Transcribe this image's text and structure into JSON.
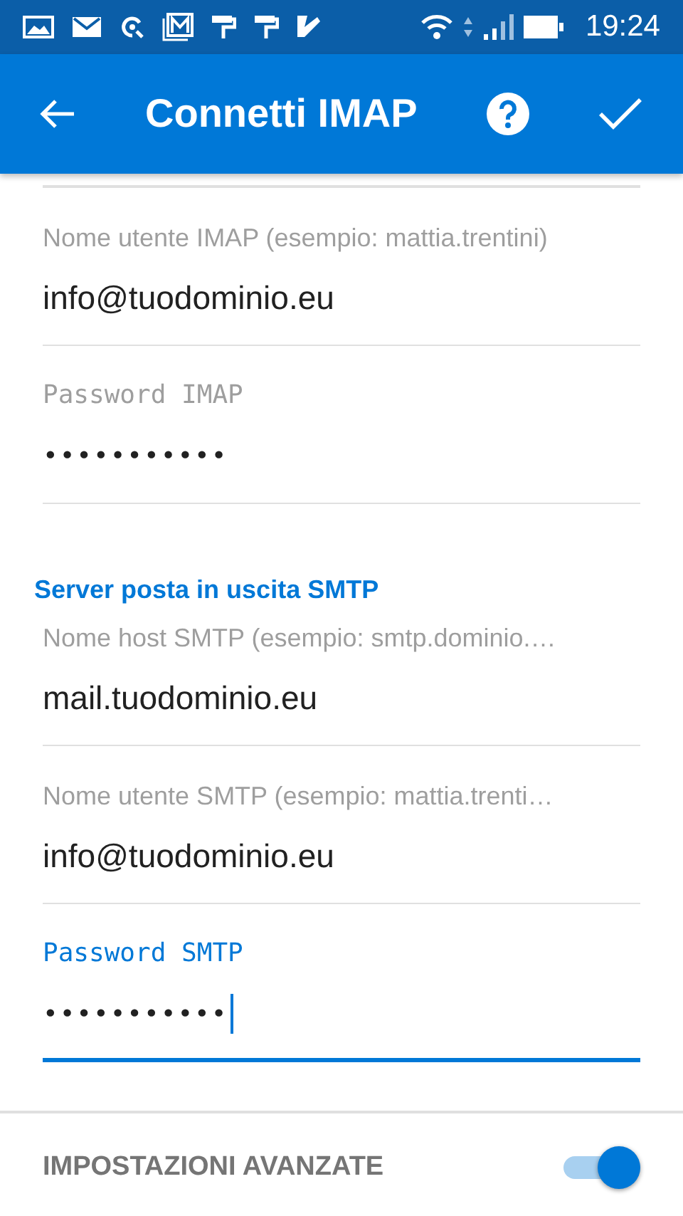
{
  "status_bar": {
    "time": "19:24"
  },
  "app_bar": {
    "title": "Connetti IMAP"
  },
  "imap_fields": [
    {
      "kind": "text",
      "label": "Nome utente IMAP (esempio: mattia.trentini)",
      "value": "info@tuodominio.eu",
      "focused": false
    },
    {
      "kind": "password",
      "label": "Password IMAP",
      "value": "•••••••••••",
      "focused": false
    }
  ],
  "smtp_section": {
    "heading": "Server posta in uscita SMTP",
    "fields": [
      {
        "kind": "text",
        "label": "Nome host SMTP (esempio: smtp.dominio.…",
        "value": "mail.tuodominio.eu",
        "focused": false
      },
      {
        "kind": "text",
        "label": "Nome utente SMTP (esempio: mattia.trenti…",
        "value": "info@tuodominio.eu",
        "focused": false
      },
      {
        "kind": "password",
        "label": "Password SMTP",
        "value": "•••••••••••",
        "focused": true
      }
    ]
  },
  "advanced": {
    "label": "IMPOSTAZIONI AVANZATE",
    "on": true
  }
}
